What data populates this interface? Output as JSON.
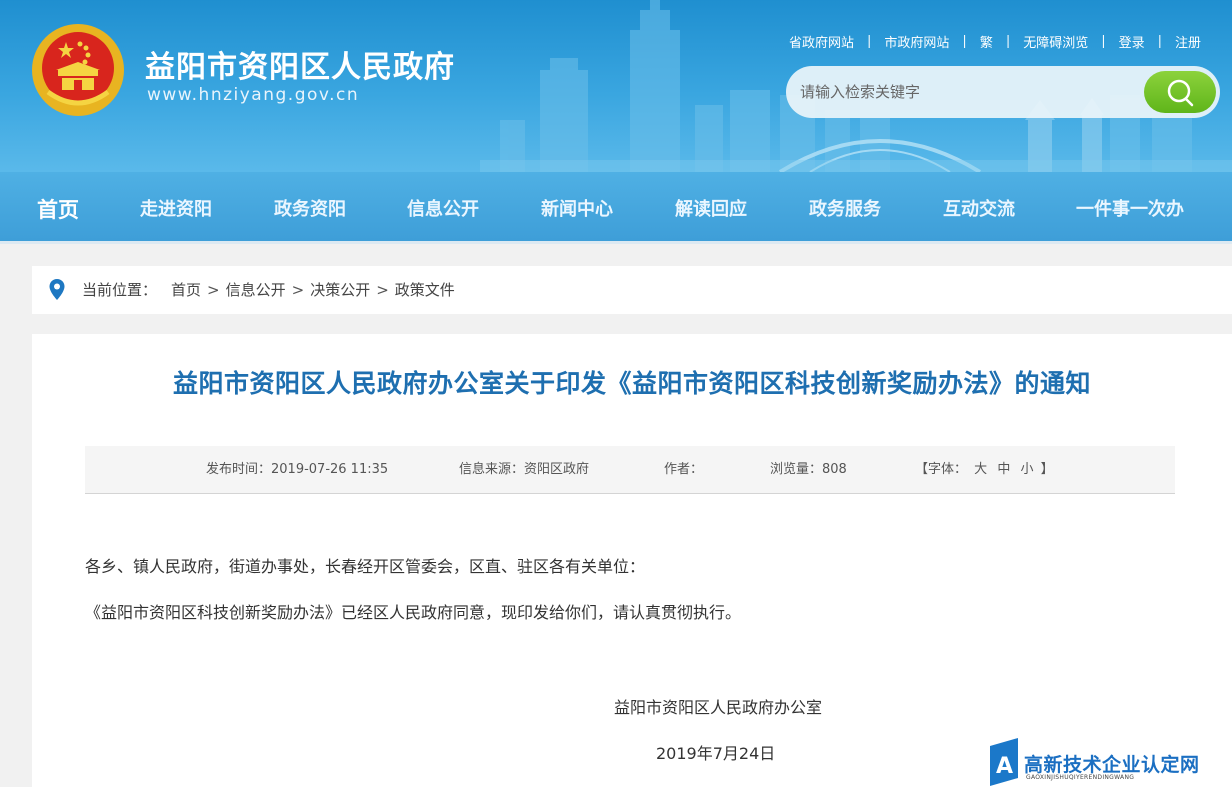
{
  "header": {
    "title": "益阳市资阳区人民政府",
    "url": "www.hnziyang.gov.cn",
    "top_links": [
      "省政府网站",
      "市政府网站",
      "繁",
      "无障碍浏览",
      "登录",
      "注册"
    ],
    "search_placeholder": "请输入检索关键字"
  },
  "nav": {
    "items": [
      "首页",
      "走进资阳",
      "政务资阳",
      "信息公开",
      "新闻中心",
      "解读回应",
      "政务服务",
      "互动交流",
      "一件事一次办"
    ],
    "active": "首页"
  },
  "breadcrumb": {
    "label": "当前位置：",
    "items": [
      "首页",
      "信息公开",
      "决策公开",
      "政策文件"
    ],
    "separator": ">"
  },
  "article": {
    "title": "益阳市资阳区人民政府办公室关于印发《益阳市资阳区科技创新奖励办法》的通知",
    "meta": {
      "publish_time": "发布时间：2019-07-26 11:35",
      "source": "信息来源：资阳区政府",
      "author": "作者：",
      "views": "浏览量：808",
      "font_size_prefix": "【字体：",
      "font_sizes": [
        "大",
        "中",
        "小"
      ],
      "font_size_suffix": "】"
    },
    "paragraphs": [
      "各乡、镇人民政府，街道办事处，长春经开区管委会，区直、驻区各有关单位：",
      "《益阳市资阳区科技创新奖励办法》已经区人民政府同意，现印发给你们，请认真贯彻执行。"
    ],
    "signature": "益阳市资阳区人民政府办公室",
    "date": "2019年7月24日"
  },
  "watermark": {
    "text": "高新技术企业认定网",
    "sub": "GAOXINJISHUQIYERENDINGWANG"
  },
  "colors": {
    "header_blue": "#2a9bd8",
    "title_blue": "#1e6fb0",
    "search_green": "#6cc023"
  }
}
